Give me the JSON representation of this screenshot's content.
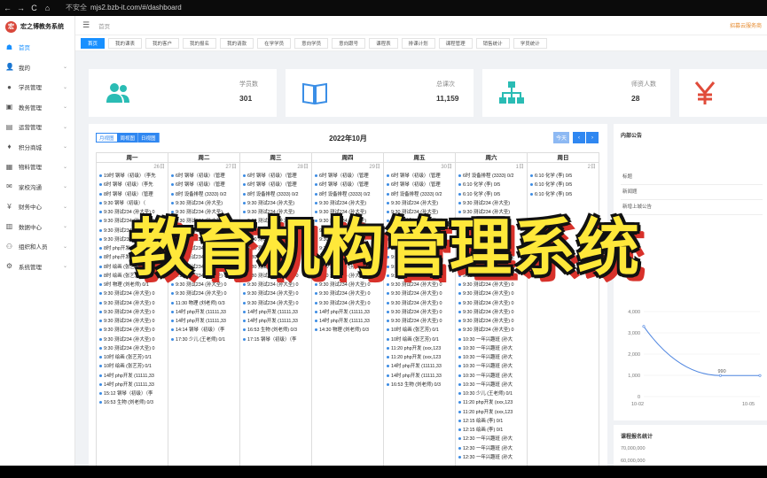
{
  "browser": {
    "back": "←",
    "forward": "→",
    "reload": "C",
    "home": "⌂",
    "warning": "不安全",
    "url": "mjs2.bzb-it.com/#/dashboard"
  },
  "app": {
    "brand_name": "宏之博教务系统",
    "brand_logo_char": "宏",
    "breadcrumb": "首页",
    "user_text": "招募云服务商",
    "colors": {
      "accent": "#1890ff",
      "teal": "#2abcb4",
      "red": "#e04b3a",
      "overlay": "#ffe83a"
    }
  },
  "sidebar": {
    "items": [
      {
        "label": "首页",
        "icon": "home-icon",
        "glyph": "☗"
      },
      {
        "label": "我的",
        "icon": "user-icon",
        "glyph": "👤"
      },
      {
        "label": "学员管理",
        "icon": "student-icon",
        "glyph": "●"
      },
      {
        "label": "教务管理",
        "icon": "teaching-icon",
        "glyph": "▣"
      },
      {
        "label": "运营管理",
        "icon": "operation-icon",
        "glyph": "▤"
      },
      {
        "label": "积分商城",
        "icon": "mall-icon",
        "glyph": "♦"
      },
      {
        "label": "物料管理",
        "icon": "material-icon",
        "glyph": "▦"
      },
      {
        "label": "家校沟通",
        "icon": "communication-icon",
        "glyph": "✉"
      },
      {
        "label": "财务中心",
        "icon": "finance-icon",
        "glyph": "¥"
      },
      {
        "label": "数据中心",
        "icon": "data-icon",
        "glyph": "▥"
      },
      {
        "label": "组织和人员",
        "icon": "org-icon",
        "glyph": "⚇"
      },
      {
        "label": "系统管理",
        "icon": "settings-icon",
        "glyph": "⚙"
      }
    ]
  },
  "tabs": [
    "首页",
    "我的课表",
    "我的客户",
    "我的报名",
    "我的请款",
    "在学学员",
    "意向学员",
    "意向跟号",
    "课程表",
    "排课计划",
    "课程管理",
    "销售统计",
    "学员统计"
  ],
  "stats": [
    {
      "title": "学员数",
      "value": "301",
      "icon": "users-icon"
    },
    {
      "title": "总课次",
      "value": "11,159",
      "icon": "book-icon"
    },
    {
      "title": "师资人数",
      "value": "28",
      "icon": "org-chart-icon"
    },
    {
      "title": "",
      "value": "",
      "icon": "yen-icon"
    }
  ],
  "calendar": {
    "title": "2022年10月",
    "view_buttons": [
      "月视图",
      "周视图",
      "日视图"
    ],
    "today": "今天",
    "prev": "‹",
    "next": "›",
    "days": [
      {
        "name": "周一",
        "date": "26日",
        "events": [
          "19时 钢琴（初级）（李先",
          "6时 钢琴（初级）（李先",
          "8时 钢琴（初级）（管理",
          "9:30 钢琴（初级）（",
          "9:30 测试234 (孙大圣) 0",
          "9:30 测试234 (孙大圣) 0",
          "9:30 测试234 (孙大圣) 0",
          "9:30 测试234 (孙大圣) 0",
          "8时 php开发 (11111,33",
          "8时 php开发 (11111,33",
          "8时 绘画 (张艺芳) 0/1",
          "8时 绘画 (张艺芳) 0/1",
          "9时 物理 (刘老师) 0/1",
          "9:30 测试234 (孙大圣) 0",
          "9:30 测试234 (孙大圣) 0",
          "9:30 测试234 (孙大圣) 0",
          "9:30 测试234 (孙大圣) 0",
          "9:30 测试234 (孙大圣) 0",
          "9:30 测试234 (孙大圣) 0",
          "9:30 测试234 (孙大圣) 0",
          "10时 绘画 (张艺芳) 0/1",
          "10时 绘画 (张艺芳) 0/1",
          "14时 php开发 (11111,33",
          "14时 php开发 (11111,33",
          "15:12 钢琴（初级）（李",
          "16:53 生物 (刘老师) 0/3"
        ]
      },
      {
        "name": "周二",
        "date": "27日",
        "events": [
          "6时 钢琴（初级）（管理",
          "6时 钢琴（初级）（管理",
          "8时 设备排程 (3333) 0/2",
          "9:30 测试234 (孙大圣)",
          "9:30 测试234 (孙大圣)",
          "9:30 测试234 (孙大圣)",
          "9:30 测试234 (孙大圣)",
          "9:30 测试234 (孙大圣)",
          "9:30 测试234 (孙大圣) 0",
          "9:30 测试234 (孙大圣) 0",
          "9:30 测试234 (孙大圣) 0",
          "9:30 测试234 (孙大圣) 0",
          "9:30 测试234 (孙大圣) 0",
          "9:30 测试234 (孙大圣) 0",
          "11:30 物理 (刘老师) 0/3",
          "14时 php开发 (11111,33",
          "14时 php开发 (11111,33",
          "14:14 钢琴（初级）（李",
          "17:30 少儿 (王老师) 0/1"
        ]
      },
      {
        "name": "周三",
        "date": "28日",
        "events": [
          "6时 钢琴（初级）（管理",
          "6时 钢琴（初级）（管理",
          "8时 设备排程 (3333) 0/2",
          "9:30 测试234 (孙大圣)",
          "9:30 测试234 (孙大圣)",
          "9:30 测试234 (孙大圣)",
          "9:30 测试234 (孙大圣)",
          "9:30 测试234 (孙大圣)",
          "9:30 测试234 (孙大圣) 0",
          "9:30 测试234 (孙大圣) 0",
          "9:30 测试234 (孙大圣) 0",
          "9:30 测试234 (孙大圣) 0",
          "9:30 测试234 (孙大圣) 0",
          "9:30 测试234 (孙大圣) 0",
          "9:30 测试234 (孙大圣) 0",
          "14时 php开发 (11111,33",
          "14时 php开发 (11111,33",
          "16:53 生物 (刘老师) 0/3",
          "17:15 钢琴（初级）（李"
        ]
      },
      {
        "name": "周四",
        "date": "29日",
        "events": [
          "6时 钢琴（初级）（管理",
          "6时 钢琴（初级）（管理",
          "8时 设备排程 (3333) 0/2",
          "9:30 测试234 (孙大圣)",
          "9:30 测试234 (孙大圣)",
          "9:30 测试234 (孙大圣)",
          "9:30 测试234 (孙大圣)",
          "9:30 测试234 (孙大圣)",
          "9:30 测试234 (孙大圣) 0",
          "9:30 测试234 (孙大圣) 0",
          "9:30 测试234 (孙大圣) 0",
          "9:30 测试234 (孙大圣) 0",
          "9:30 测试234 (孙大圣) 0",
          "9:30 测试234 (孙大圣) 0",
          "9:30 测试234 (孙大圣) 0",
          "14时 php开发 (11111,33",
          "14时 php开发 (11111,33",
          "14:30 物理 (刘老师) 0/3"
        ]
      },
      {
        "name": "周五",
        "date": "30日",
        "events": [
          "6时 钢琴（初级）（管理",
          "6时 钢琴（初级）（管理",
          "8时 设备排程 (3333) 0/2",
          "9:30 测试234 (孙大圣)",
          "9:30 测试234 (孙大圣)",
          "9:30 测试234 (孙大圣)",
          "9:30 测试234 (孙大圣)",
          "9:30 测试234 (孙大圣)",
          "8:30 111 (杨) 0/0",
          "9:30 试听课 (李四老师)",
          "9:30 测试234 (孙大圣) 0",
          "9:30 测试234 (孙大圣) 0",
          "9:30 测试234 (孙大圣) 0",
          "9:30 测试234 (孙大圣) 0",
          "9:30 测试234 (孙大圣) 0",
          "9:30 测试234 (孙大圣) 0",
          "9:30 测试234 (孙大圣) 0",
          "10时 绘画 (张艺芳) 0/1",
          "10时 绘画 (张艺芳) 0/1",
          "11:20 php开发 (xxx,123",
          "11:20 php开发 (xxx,123",
          "14时 php开发 (11111,33",
          "14时 php开发 (11111,33",
          "16:53 生物 (刘老师) 0/3"
        ]
      },
      {
        "name": "周六",
        "date": "1日",
        "events": [
          "6时 设备排程 (3333) 0/2",
          "6:10 化学 (李) 0/5",
          "6:10 化学 (李) 0/5",
          "9:30 测试234 (孙大圣)",
          "9:30 测试234 (孙大圣)",
          "9:30 测试234 (孙大圣)",
          "9:30 测试234 (孙大圣)",
          "9:30 测试234 (孙大圣)",
          "9:30 测试234 (孙大圣) 0",
          "9:30 一年兴趣班 (孙大圣",
          "9:30 一年兴趣班 (孙大圣",
          "9:30 试听课 (李四老师)",
          "9:30 测试234 (孙大圣) 0",
          "9:30 测试234 (孙大圣) 0",
          "9:30 测试234 (孙大圣) 0",
          "9:30 测试234 (孙大圣) 0",
          "9:30 测试234 (孙大圣) 0",
          "9:30 测试234 (孙大圣) 0",
          "10:30 一年兴趣班 (孙大",
          "10:30 一年兴趣班 (孙大",
          "10:30 一年兴趣班 (孙大",
          "10:30 一年兴趣班 (孙大",
          "10:30 一年兴趣班 (孙大",
          "10:30 一年兴趣班 (孙大",
          "10:30 少儿 (王老师) 0/1",
          "11:20 php开发 (xxx,123",
          "11:20 php开发 (xxx,123",
          "12:15 绘画 (李) 0/1",
          "12:15 绘画 (李) 0/1",
          "12:30 一年兴趣班 (孙大",
          "12:30 一年兴趣班 (孙大",
          "12:30 一年兴趣班 (孙大"
        ]
      },
      {
        "name": "周日",
        "date": "2日",
        "events": [
          "6:10 化学 (李) 0/5",
          "6:10 化学 (李) 0/5",
          "6:10 化学 (李) 0/5"
        ]
      }
    ]
  },
  "notice": {
    "title": "内部公告",
    "items": [
      "标题",
      "新闻题",
      "新增上城公告"
    ]
  },
  "chart_data": {
    "type": "line",
    "x": [
      "10-02",
      "10-05"
    ],
    "y_ticks": [
      "4,000",
      "3,000",
      "2,000",
      "1,000",
      "0"
    ],
    "ylim": [
      0,
      4000
    ],
    "series": [
      {
        "values": [
          3300,
          990,
          990
        ]
      }
    ],
    "point_label": "990",
    "color": "#4f86e0"
  },
  "registration": {
    "title": "课程报名统计",
    "ticks": [
      "70,000,000",
      "60,000,000"
    ]
  },
  "overlay": {
    "text": "教育机构管理系统"
  }
}
